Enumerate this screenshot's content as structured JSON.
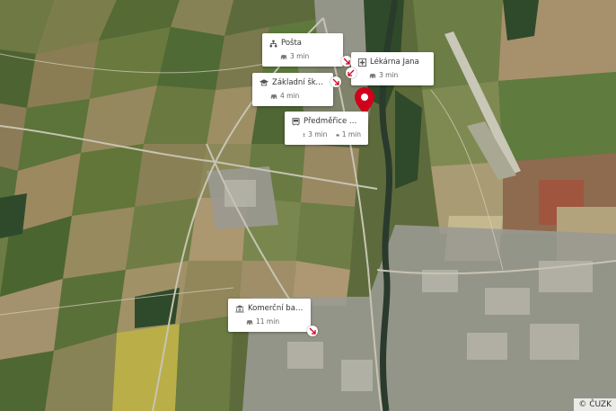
{
  "map": {
    "imagery": "satellite",
    "copyright": "© ČUZK"
  },
  "selected_location": {
    "marker": "map-pin-icon",
    "color": "#d0021b"
  },
  "pois": [
    {
      "name": "Pošta",
      "icon": "post-office-icon",
      "travel": [
        {
          "mode": "car-icon",
          "time": "3 min"
        }
      ]
    },
    {
      "name": "Lékárna Jana",
      "icon": "pharmacy-icon",
      "travel": [
        {
          "mode": "car-icon",
          "time": "3 min"
        }
      ]
    },
    {
      "name": "Základní škola a ...",
      "icon": "school-icon",
      "travel": [
        {
          "mode": "car-icon",
          "time": "4 min"
        }
      ]
    },
    {
      "name": "Předměřice Labem",
      "icon": "bus-stop-icon",
      "travel": [
        {
          "mode": "walk-icon",
          "time": "3 min"
        },
        {
          "mode": "car-icon",
          "time": "1 min"
        }
      ]
    },
    {
      "name": "Komerční banka",
      "icon": "bank-icon",
      "travel": [
        {
          "mode": "car-icon",
          "time": "11 min"
        }
      ]
    }
  ]
}
